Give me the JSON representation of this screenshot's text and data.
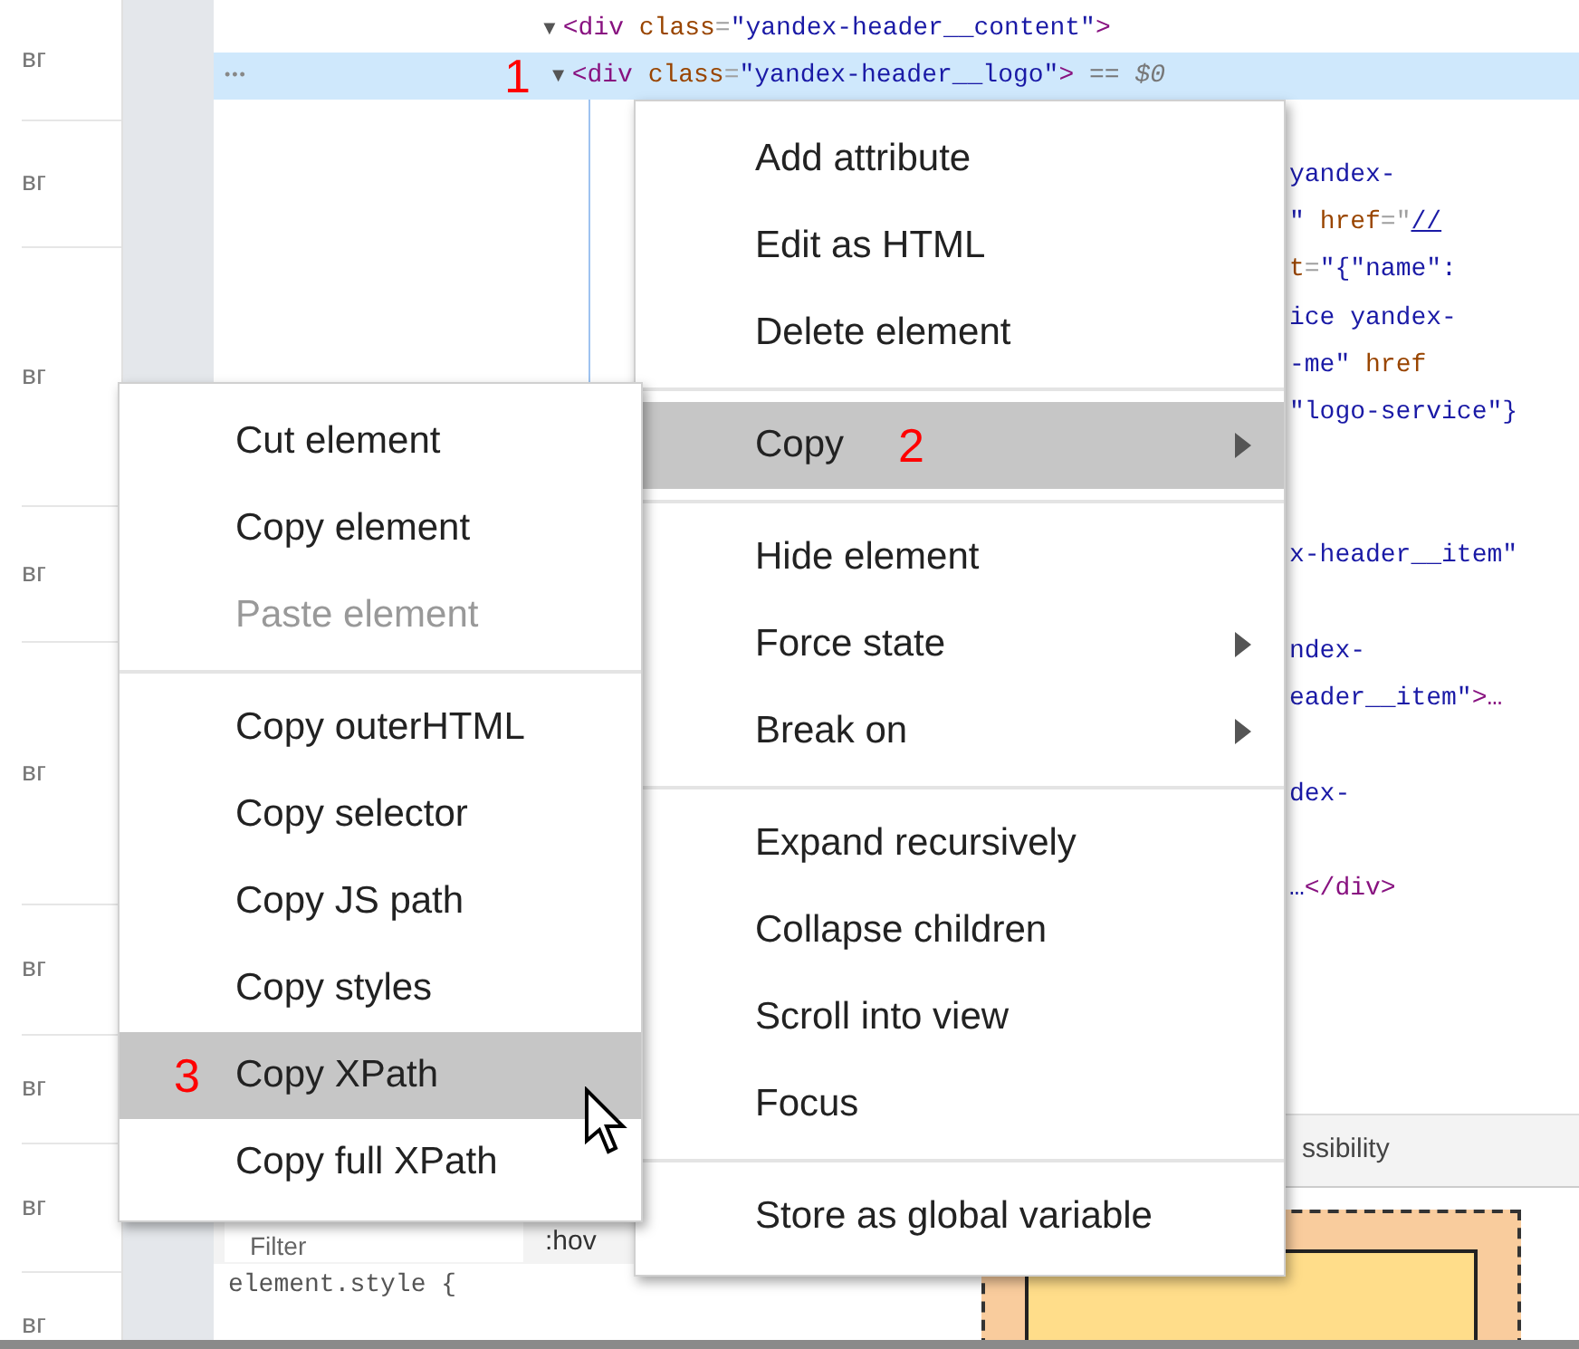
{
  "left_list": {
    "rows": [
      "вг",
      "вг",
      "вг",
      "вг",
      "вг",
      "вг",
      "вг",
      "вг",
      "вг"
    ]
  },
  "elements_tree": {
    "lines": [
      {
        "toggle": "▼",
        "expanded": true,
        "selected": false,
        "parts": [
          {
            "kind": "tag",
            "text": "<div"
          },
          {
            "kind": "attr",
            "text": " class"
          },
          {
            "kind": "punct",
            "text": "="
          },
          {
            "kind": "value",
            "text": "\"yandex-header__content\""
          },
          {
            "kind": "tag",
            "text": ">"
          }
        ],
        "children": [
          {
            "toggle": "▼",
            "expanded": true,
            "selected": true,
            "ellipsis": "•••",
            "annotation": "1",
            "suffix": "== $0",
            "parts": [
              {
                "kind": "tag",
                "text": "<div"
              },
              {
                "kind": "attr",
                "text": " class"
              },
              {
                "kind": "punct",
                "text": "="
              },
              {
                "kind": "value",
                "text": "\"yandex-header__logo\""
              },
              {
                "kind": "tag",
                "text": ">"
              }
            ]
          }
        ]
      }
    ],
    "fragments": [
      [
        {
          "kind": "value",
          "text": "yandex-"
        }
      ],
      [
        {
          "kind": "value",
          "text": "\" "
        },
        {
          "kind": "attr",
          "text": "href"
        },
        {
          "kind": "punct",
          "text": "=\""
        },
        {
          "kind": "link",
          "text": "//"
        }
      ],
      [
        {
          "kind": "attr",
          "text": "t"
        },
        {
          "kind": "punct",
          "text": "="
        },
        {
          "kind": "value",
          "text": "\"{\"name\":"
        }
      ],
      [
        {
          "kind": "value",
          "text": "ice yandex-"
        }
      ],
      [
        {
          "kind": "value",
          "text": "-me\" "
        },
        {
          "kind": "attr",
          "text": "href"
        }
      ],
      [
        {
          "kind": "value",
          "text": "\"logo-service\"}"
        }
      ],
      [
        {
          "kind": "value",
          "text": "x-header__item\""
        }
      ],
      [
        {
          "kind": "value",
          "text": "ndex-"
        }
      ],
      [
        {
          "kind": "value",
          "text": "eader__item\""
        },
        {
          "kind": "tag",
          "text": ">…"
        }
      ],
      [
        {
          "kind": "value",
          "text": "dex-"
        }
      ],
      [
        {
          "kind": "value",
          "text": "…"
        },
        {
          "kind": "tag",
          "text": "</div>"
        }
      ]
    ]
  },
  "lower_panel": {
    "tabs": [
      {
        "label": "ssibility",
        "selected": false
      }
    ],
    "filter": {
      "placeholder": "Filter"
    },
    "hov_button": ":hov",
    "style_rule": "element.style {"
  },
  "context_menu": {
    "groups": [
      [
        {
          "label": "Add attribute",
          "selected": false,
          "disabled": false,
          "submenu": false
        },
        {
          "label": "Edit as HTML",
          "selected": false,
          "disabled": false,
          "submenu": false
        },
        {
          "label": "Delete element",
          "selected": false,
          "disabled": false,
          "submenu": false
        }
      ],
      [
        {
          "label": "Copy",
          "selected": true,
          "disabled": false,
          "submenu": true,
          "annotation": "2"
        }
      ],
      [
        {
          "label": "Hide element",
          "selected": false,
          "disabled": false,
          "submenu": false
        },
        {
          "label": "Force state",
          "selected": false,
          "disabled": false,
          "submenu": true
        },
        {
          "label": "Break on",
          "selected": false,
          "disabled": false,
          "submenu": true
        }
      ],
      [
        {
          "label": "Expand recursively",
          "selected": false,
          "disabled": false,
          "submenu": false
        },
        {
          "label": "Collapse children",
          "selected": false,
          "disabled": false,
          "submenu": false
        },
        {
          "label": "Scroll into view",
          "selected": false,
          "disabled": false,
          "submenu": false
        },
        {
          "label": "Focus",
          "selected": false,
          "disabled": false,
          "submenu": false
        }
      ],
      [
        {
          "label": "Store as global variable",
          "selected": false,
          "disabled": false,
          "submenu": false
        }
      ]
    ]
  },
  "copy_submenu": {
    "groups": [
      [
        {
          "label": "Cut element",
          "selected": false,
          "disabled": false,
          "submenu": false
        },
        {
          "label": "Copy element",
          "selected": false,
          "disabled": false,
          "submenu": false
        },
        {
          "label": "Paste element",
          "selected": false,
          "disabled": true,
          "submenu": false
        }
      ],
      [
        {
          "label": "Copy outerHTML",
          "selected": false,
          "disabled": false,
          "submenu": false
        },
        {
          "label": "Copy selector",
          "selected": false,
          "disabled": false,
          "submenu": false
        },
        {
          "label": "Copy JS path",
          "selected": false,
          "disabled": false,
          "submenu": false
        },
        {
          "label": "Copy styles",
          "selected": false,
          "disabled": false,
          "submenu": false
        },
        {
          "label": "Copy XPath",
          "selected": true,
          "disabled": false,
          "submenu": false,
          "annotation": "3"
        },
        {
          "label": "Copy full XPath",
          "selected": false,
          "disabled": false,
          "submenu": false
        }
      ]
    ]
  }
}
